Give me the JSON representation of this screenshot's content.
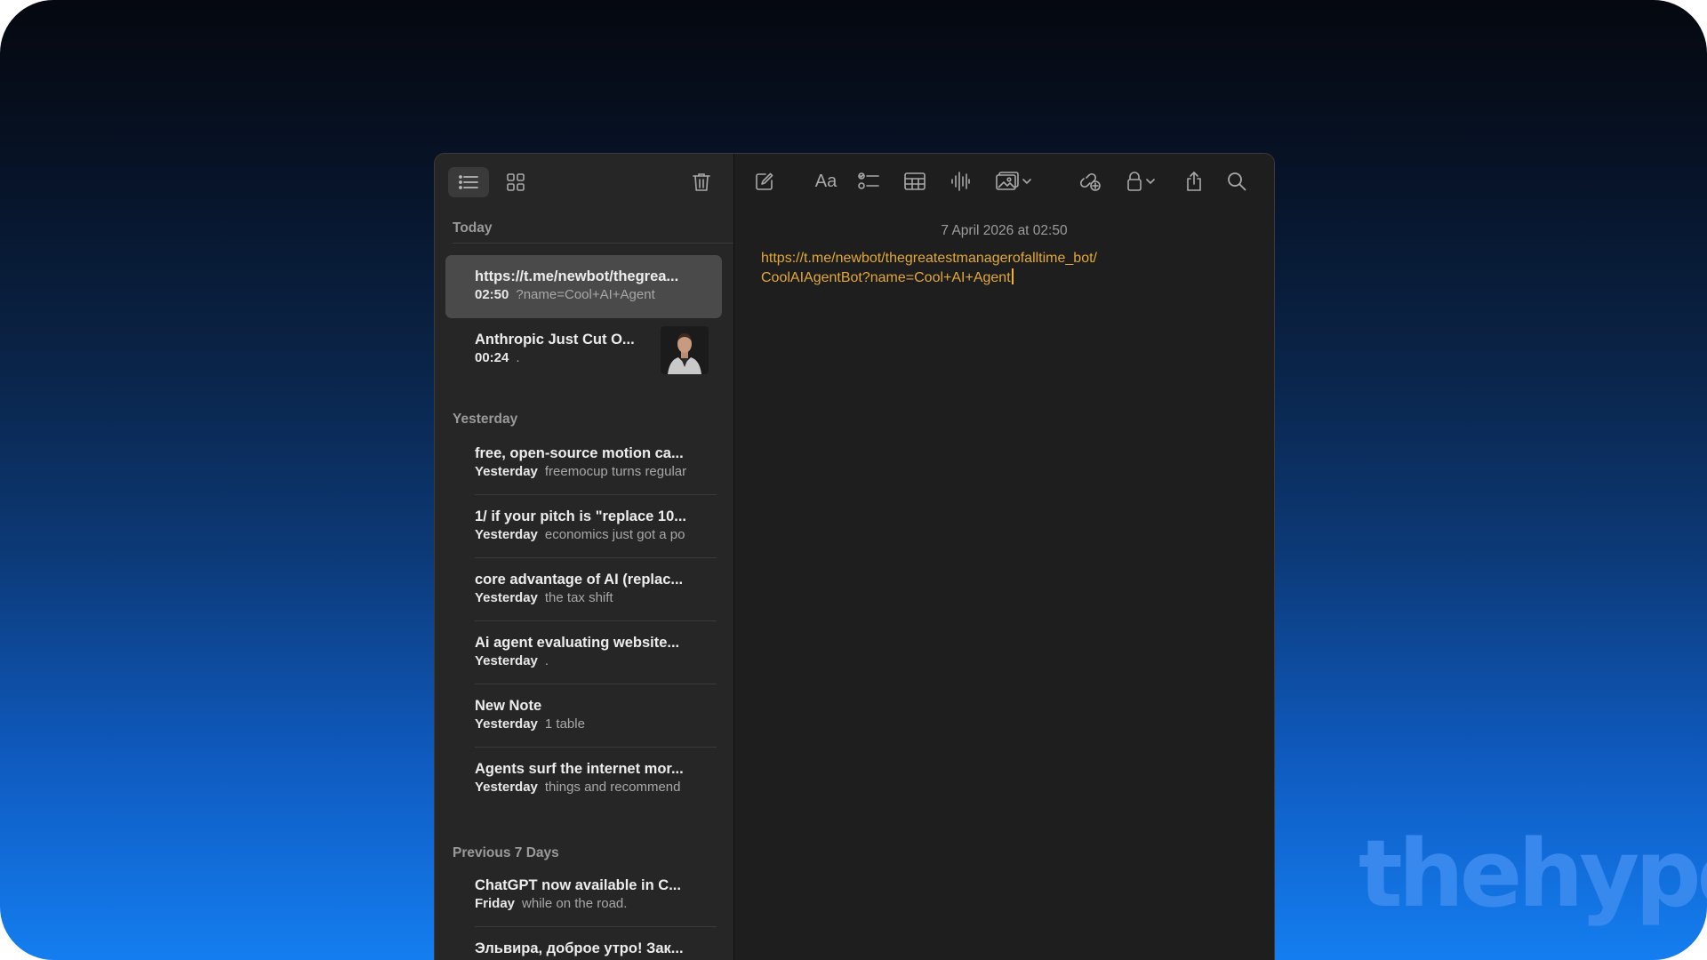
{
  "sidebar": {
    "sections": {
      "today": "Today",
      "yesterday": "Yesterday",
      "previous": "Previous 7 Days"
    },
    "notes": [
      {
        "title": "https://t.me/newbot/thegrea...",
        "time": "02:50",
        "preview": "?name=Cool+AI+Agent",
        "selected": true
      },
      {
        "title": "Anthropic Just Cut O...",
        "time": "00:24",
        "preview": "."
      },
      {
        "title": "free, open-source motion ca...",
        "time": "Yesterday",
        "preview": "freemocup turns regular"
      },
      {
        "title": "1/ if your pitch is \"replace 10...",
        "time": "Yesterday",
        "preview": "economics just got a po"
      },
      {
        "title": "core advantage of AI (replac...",
        "time": "Yesterday",
        "preview": "the tax shift"
      },
      {
        "title": "Ai agent evaluating website...",
        "time": "Yesterday",
        "preview": "."
      },
      {
        "title": "New Note",
        "time": "Yesterday",
        "preview": "1 table"
      },
      {
        "title": "Agents surf the internet mor...",
        "time": "Yesterday",
        "preview": "things and recommend"
      },
      {
        "title": "ChatGPT now available in C...",
        "time": "Friday",
        "preview": "while on the road."
      },
      {
        "title": "Эльвира, доброе утро! Зак...",
        "time": "",
        "preview": ""
      }
    ]
  },
  "editor": {
    "date": "7 April 2026 at 02:50",
    "body_line1": "https://t.me/newbot/thegreatestmanagerofalltime_bot/",
    "body_line2": "CoolAIAgentBot?name=Cool+AI+Agent"
  },
  "toolbar_icons": [
    "list-view-icon",
    "gallery-view-icon",
    "trash-icon",
    "compose-icon",
    "format-text-icon",
    "checklist-icon",
    "table-icon",
    "audio-icon",
    "media-icon",
    "collaborate-icon",
    "lock-icon",
    "share-icon",
    "search-icon"
  ],
  "format_label": "Aa",
  "watermark": "thehype.",
  "colors": {
    "accent": "#e2a83a",
    "selection": "#4a4a4a",
    "window_bg": "#1e1e1e",
    "sidebar_bg": "#262626"
  }
}
